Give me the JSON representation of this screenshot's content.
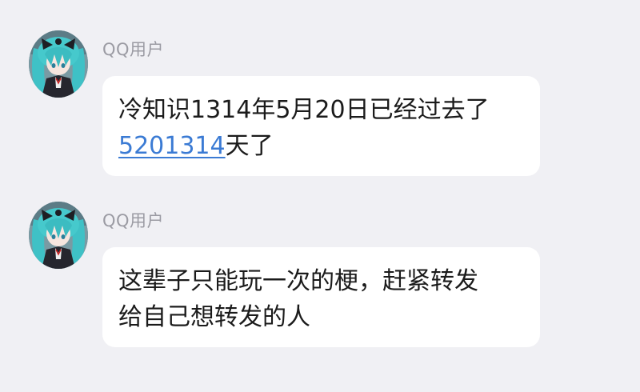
{
  "messages": [
    {
      "sender": "QQ用户",
      "line1": "冷知识1314年5月20日已经过去了",
      "link": "5201314",
      "line2_suffix": "天了"
    },
    {
      "sender": "QQ用户",
      "line1": "这辈子只能玩一次的梗，赶紧转发",
      "line2": "给自己想转发的人"
    }
  ],
  "colors": {
    "background": "#f0f0f4",
    "bubble": "#ffffff",
    "sender_name": "#9b9ba3",
    "link": "#3b7bd4",
    "text": "#1b1b1b"
  },
  "icons": {
    "avatar": "anime-avatar-icon"
  }
}
